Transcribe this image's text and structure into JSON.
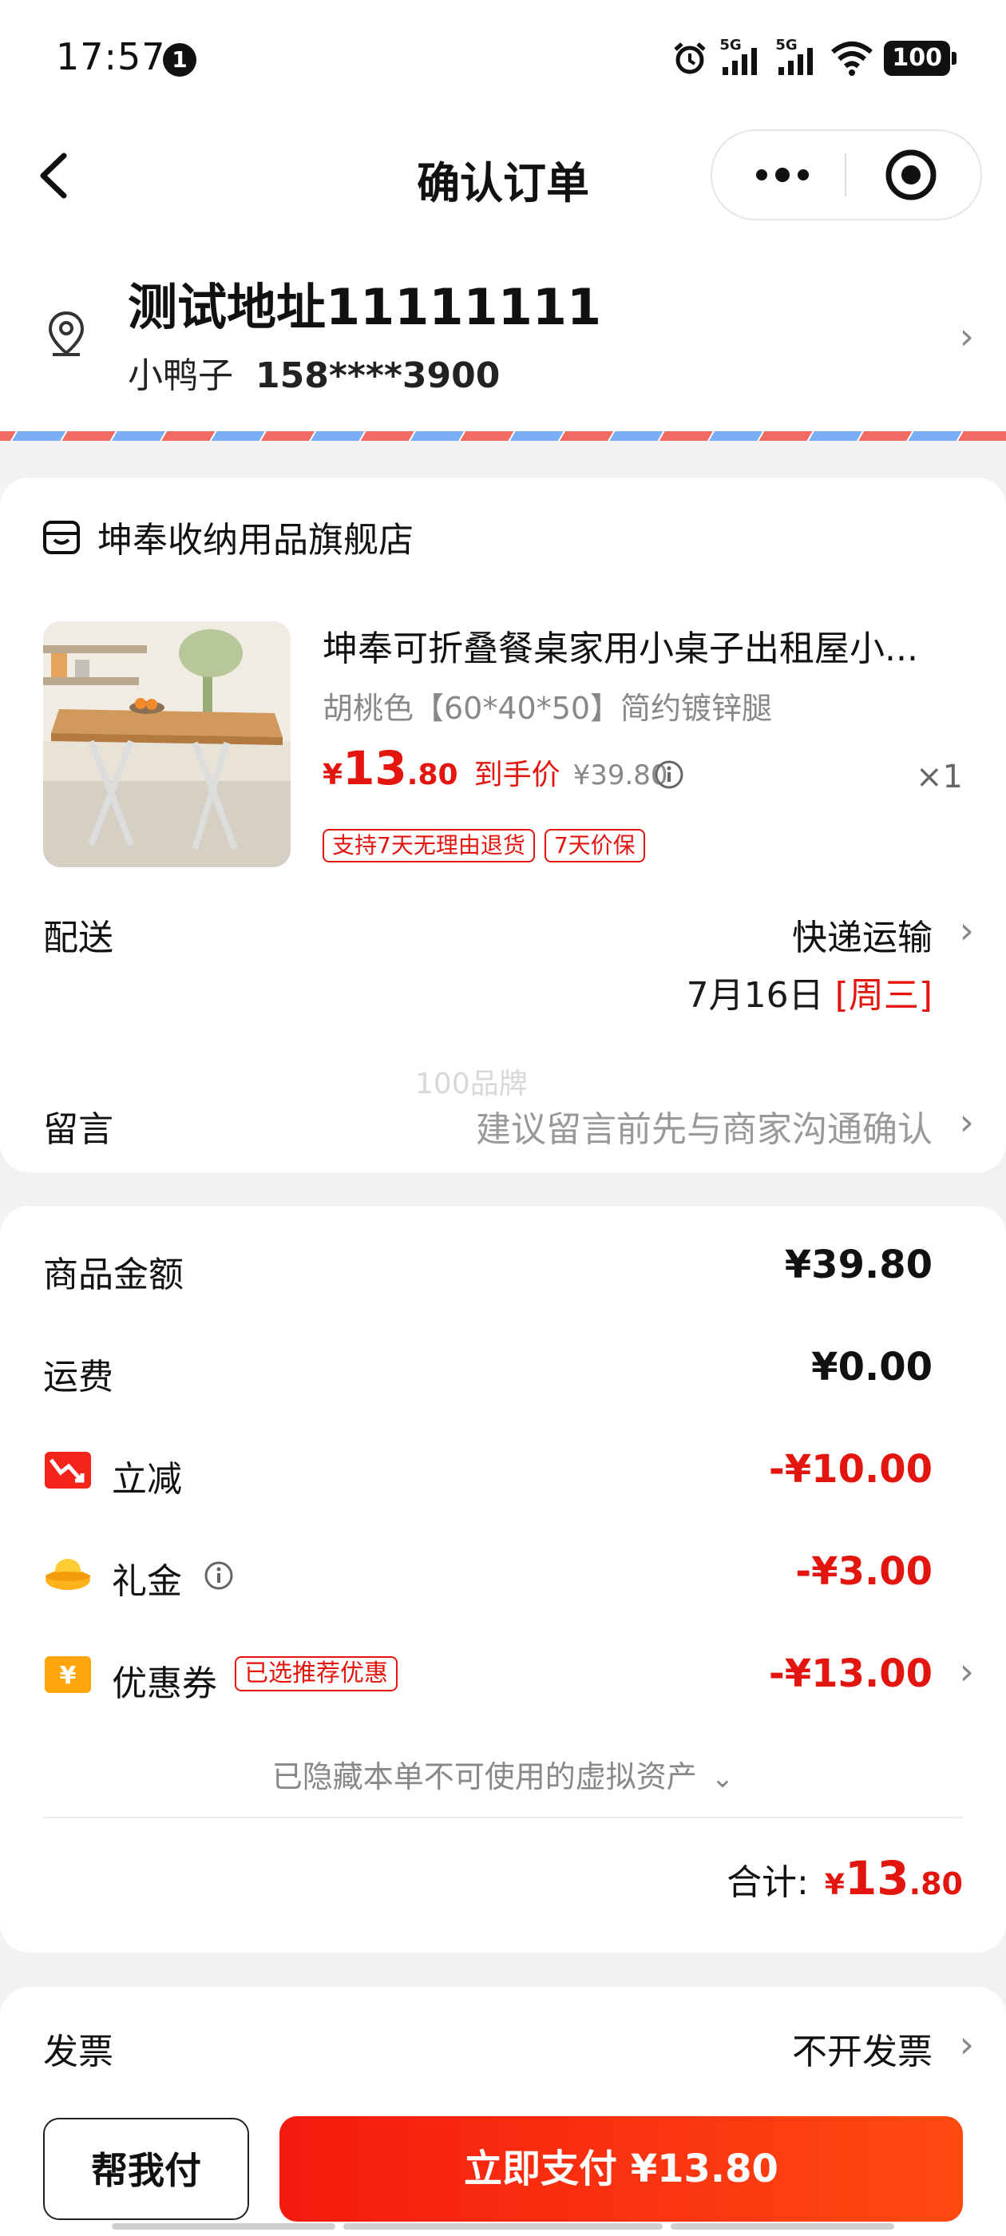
{
  "status_bar": {
    "time": "17:57",
    "notification_count": "1",
    "signal_label_1": "5G",
    "signal_label_2": "5G",
    "battery": "100"
  },
  "nav": {
    "title": "确认订单"
  },
  "address": {
    "title": "测试地址11111111",
    "name": "小鸭子",
    "phone": "158****3900"
  },
  "store": {
    "name": "坤奉收纳用品旗舰店"
  },
  "product": {
    "title": "坤奉可折叠餐桌家用小桌子出租屋小...",
    "spec": "胡桃色【60*40*50】简约镀锌腿",
    "price_symbol": "¥",
    "price_int": "13",
    "price_dec": ".80",
    "final_price_label": "到手价",
    "original_price": "¥39.80",
    "quantity": "×1",
    "tags": [
      "支持7天无理由退货",
      "7天价保"
    ]
  },
  "shipping": {
    "label": "配送",
    "method": "快递运输",
    "date": "7月16日",
    "weekday": "[周三]"
  },
  "watermark": "100品牌",
  "note": {
    "label": "留言",
    "placeholder": "建议留言前先与商家沟通确认"
  },
  "fees": {
    "goods_label": "商品金额",
    "goods_value": "¥39.80",
    "freight_label": "运费",
    "freight_value": "¥0.00",
    "discount_label": "立减",
    "discount_value": "-¥10.00",
    "gift_label": "礼金",
    "gift_value": "-¥3.00",
    "coupon_label": "优惠券",
    "coupon_tag": "已选推荐优惠",
    "coupon_value": "-¥13.00"
  },
  "hidden_assets": "已隐藏本单不可使用的虚拟资产",
  "total": {
    "label": "合计:",
    "symbol": "¥",
    "int": "13",
    "dec": ".80"
  },
  "invoice": {
    "label": "发票",
    "value": "不开发票"
  },
  "bottom": {
    "help_label": "帮我付",
    "pay_label": "立即支付 ¥13.80"
  },
  "colors": {
    "accent": "#e3150f",
    "pay_gradient_start": "#f51a0f",
    "pay_gradient_end": "#ff4a10"
  }
}
